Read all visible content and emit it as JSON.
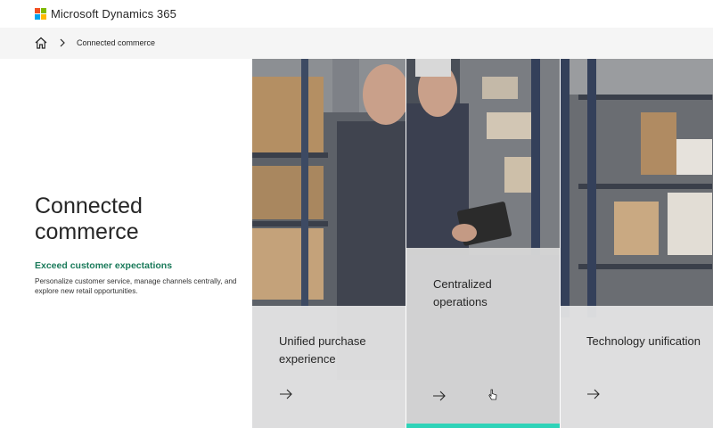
{
  "header": {
    "brand_name": "Microsoft Dynamics 365",
    "logo_colors": [
      "#f25022",
      "#7fba00",
      "#00a4ef",
      "#ffb900"
    ]
  },
  "breadcrumb": {
    "home_icon": "home-icon",
    "separator_icon": "chevron-right-icon",
    "current": "Connected commerce"
  },
  "hero": {
    "title": "Connected commerce",
    "subhead": "Exceed customer expectations",
    "description": "Personalize customer service, manage channels centrally, and explore new retail opportunities."
  },
  "cards": [
    {
      "title": "Unified purchase experience",
      "arrow_icon": "arrow-right-icon",
      "active": false
    },
    {
      "title": "Centralized operations",
      "arrow_icon": "arrow-right-icon",
      "active": true
    },
    {
      "title": "Technology unification",
      "arrow_icon": "arrow-right-icon",
      "active": false
    }
  ],
  "colors": {
    "subhead": "#1a7a5a",
    "active_accent": "#2fd3b8",
    "card_bg": "#e8e8e8",
    "active_card_bg": "#d6d6d6"
  }
}
